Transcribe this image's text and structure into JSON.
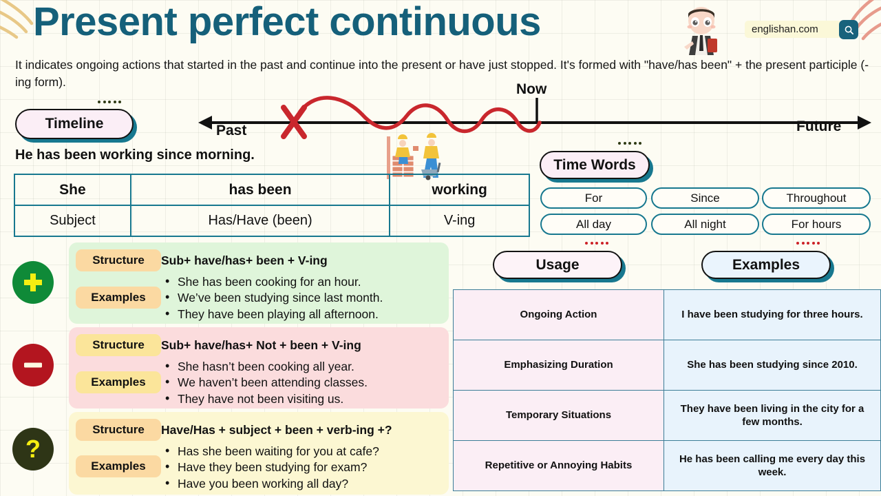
{
  "header": {
    "title": "Present perfect continuous",
    "brand": "englishan.com",
    "brand_icon": "search-icon",
    "mascot_icon": "student-character-illustration",
    "intro": "It indicates ongoing actions that started in the past and continue into the present or have just stopped. It's formed with \"have/has been\" + the present participle (-ing form)."
  },
  "timeline": {
    "badge": "Timeline",
    "past_label": "Past",
    "now_label": "Now",
    "future_label": "Future",
    "cross_icon": "red-x-mark",
    "workers_icon": "construction-workers-illustration",
    "sentence": "He has been working since morning."
  },
  "structure_table": {
    "row_top": [
      "She",
      "has been",
      "working"
    ],
    "row_bottom": [
      "Subject",
      "Has/Have (been)",
      "V-ing"
    ]
  },
  "time_words": {
    "badge": "Time Words",
    "chips": [
      "For",
      "Since",
      "Throughout",
      "All day",
      "All night",
      "For hours"
    ]
  },
  "forms": {
    "structure_label": "Structure",
    "examples_label": "Examples",
    "positive": {
      "icon": "plus-icon",
      "structure": "Sub+ have/has+ been + V-ing",
      "examples": [
        "She has been cooking for an hour.",
        "We’ve been studying since last month.",
        "They have been playing all afternoon."
      ]
    },
    "negative": {
      "icon": "minus-icon",
      "structure": "Sub+ have/has+ Not + been + V-ing",
      "examples": [
        "She hasn’t been cooking all year.",
        "We haven’t been attending classes.",
        "They have not been visiting us."
      ]
    },
    "question": {
      "icon": "question-mark-icon",
      "structure": "Have/Has + subject + been + verb-ing +?",
      "examples": [
        "Has she been waiting for you at cafe?",
        "Have they been studying for exam?",
        "Have you been working all day?"
      ]
    }
  },
  "usage_section": {
    "usage_badge": "Usage",
    "examples_badge": "Examples",
    "rows": [
      {
        "usage": "Ongoing Action",
        "example": "I have been studying for three hours."
      },
      {
        "usage": "Emphasizing Duration",
        "example": "She has been studying since 2010."
      },
      {
        "usage": "Temporary Situations",
        "example": "They have been living in the city for a few months."
      },
      {
        "usage": "Repetitive or Annoying Habits",
        "example": "He has been calling me every day this week."
      }
    ]
  },
  "colors": {
    "title_teal": "#15607a",
    "border_teal": "#17788f",
    "positive_green": "#0f8a38",
    "negative_red": "#b3151f",
    "question_olive": "#2e3516",
    "wave_red": "#c9272d",
    "background_cream": "#fdfcf3"
  }
}
